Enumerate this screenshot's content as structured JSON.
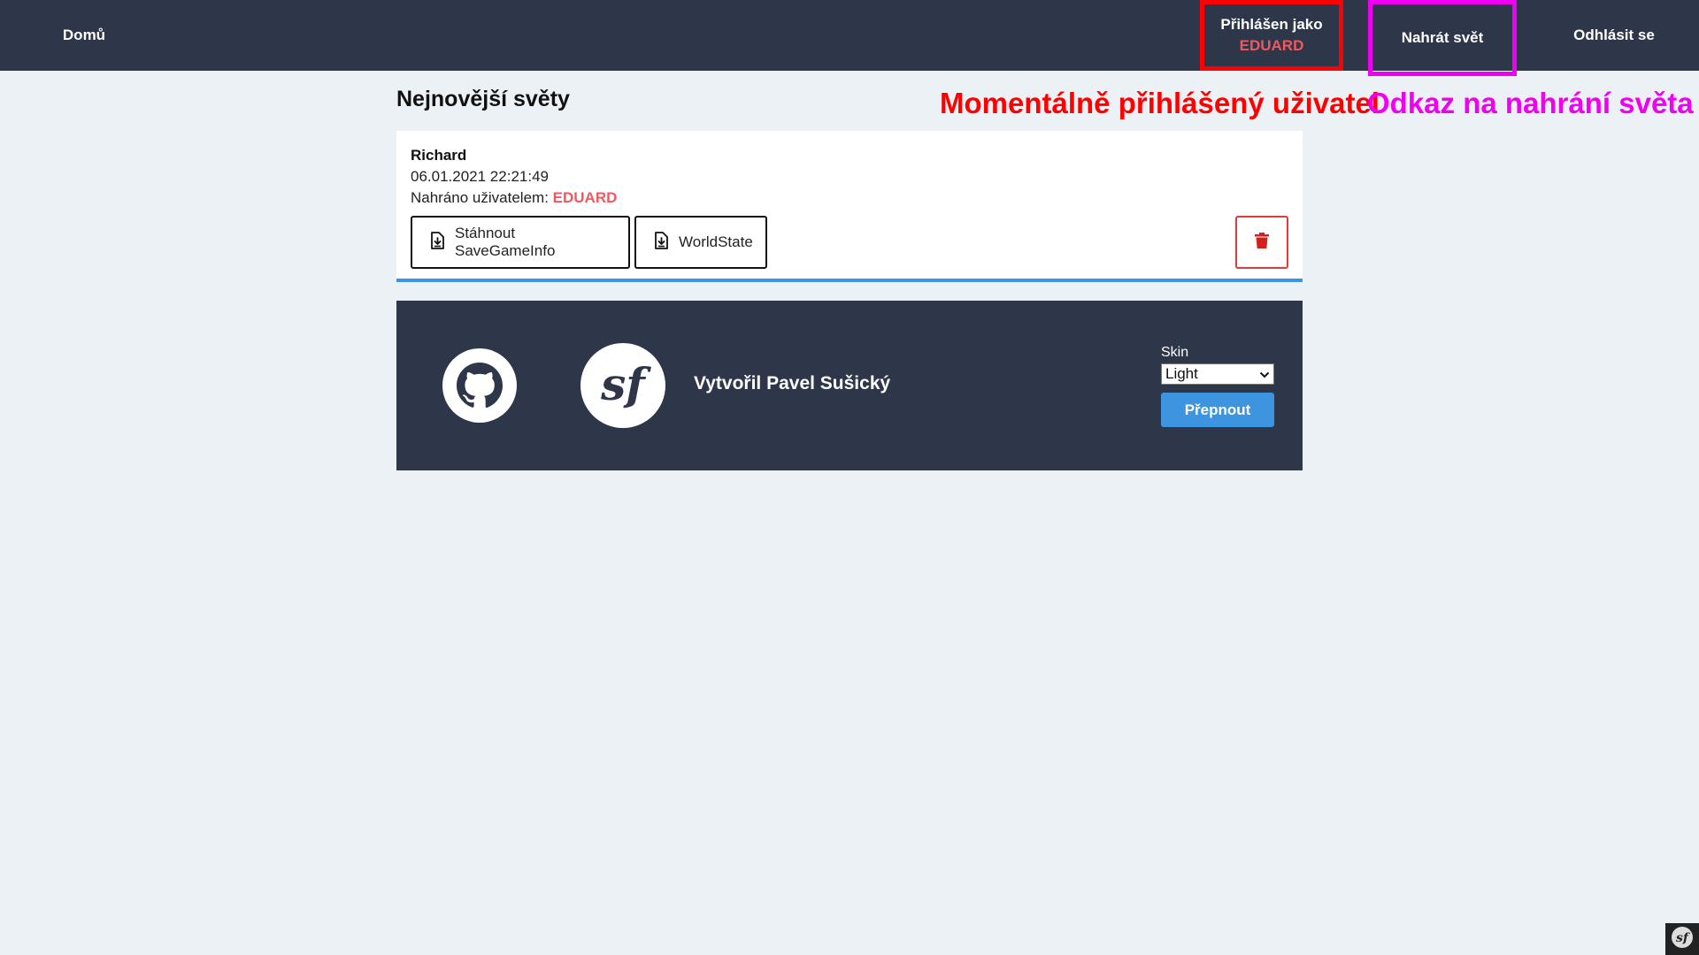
{
  "nav": {
    "home": "Domů",
    "logged_in_label": "Přihlášen jako",
    "logged_in_user": "EDUARD",
    "upload": "Nahrát svět",
    "logout": "Odhlásit se"
  },
  "annotations": {
    "current_user": "Momentálně přihlášený uživatel",
    "upload_link": "Odkaz na nahrání světa"
  },
  "page": {
    "title": "Nejnovější světy"
  },
  "worlds": [
    {
      "name": "Richard",
      "date": "06.01.2021 22:21:49",
      "uploaded_by_label": "Nahráno uživatelem:",
      "uploaded_by": "EDUARD",
      "download_savegameinfo": "Stáhnout SaveGameInfo",
      "download_worldstate": "WorldState"
    }
  ],
  "footer": {
    "credit": "Vytvořil Pavel Sušický",
    "skin_label": "Skin",
    "skin_selected": "Light",
    "switch_button": "Přepnout"
  },
  "colors": {
    "navbar_bg": "#2e3649",
    "page_bg": "#ecf1f5",
    "accent_blue": "#3d95e0",
    "username_red": "#f0585f",
    "annotation_red": "#ff0000",
    "annotation_magenta": "#f000f0"
  },
  "icons": {
    "download": "file-download-icon",
    "delete": "trash-icon",
    "github": "github-icon",
    "symfony": "symfony-icon",
    "select_arrow": "chevron-down-icon"
  }
}
